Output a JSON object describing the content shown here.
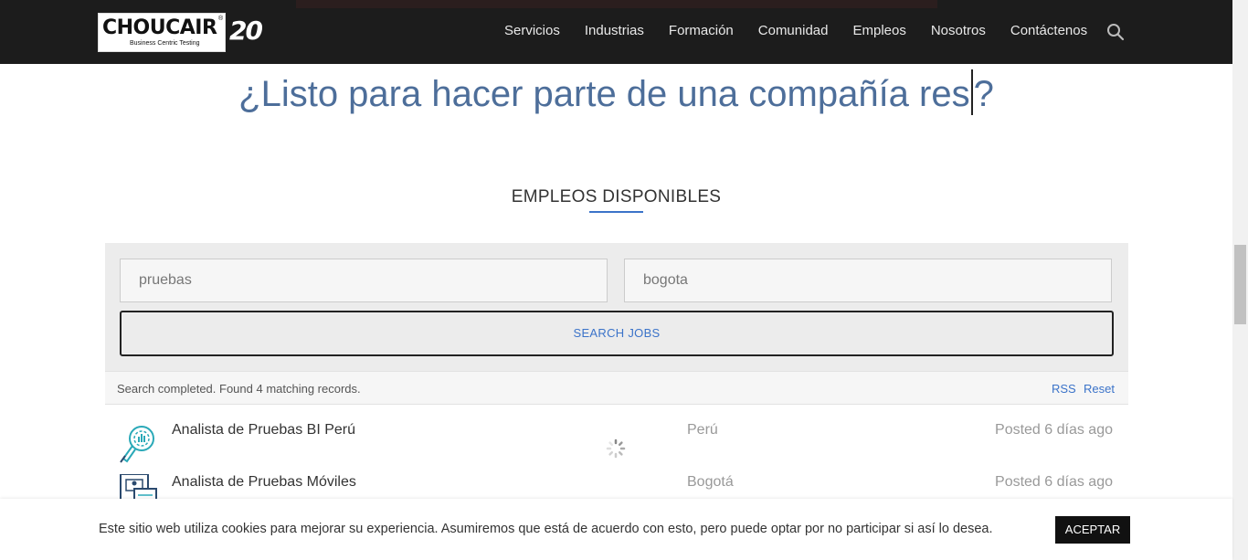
{
  "header": {
    "logo_text": "CHOUCAIR",
    "logo_tagline": "Business Centric Testing",
    "anniversary": "20",
    "nav": [
      "Servicios",
      "Industrias",
      "Formación",
      "Comunidad",
      "Empleos",
      "Nosotros",
      "Contáctenos"
    ],
    "search_icon": "search-icon"
  },
  "hero": {
    "text_before_caret": "¿Listo para hacer parte de una compañía res",
    "text_after_caret": "?"
  },
  "section": {
    "title": "EMPLEOS DISPONIBLES"
  },
  "search": {
    "keywords_value": "pruebas",
    "location_value": "bogota",
    "button_label": "SEARCH JOBS"
  },
  "results": {
    "status": "Search completed. Found 4 matching records.",
    "rss_label": "RSS",
    "reset_label": "Reset"
  },
  "jobs": [
    {
      "title": "Analista de Pruebas BI Perú",
      "location": "Perú",
      "posted": "Posted 6 días ago",
      "icon": "bi-analytics-icon"
    },
    {
      "title": "Analista de Pruebas Móviles",
      "location": "Bogotá",
      "posted": "Posted 6 días ago",
      "icon": "mobile-documents-icon"
    }
  ],
  "cookie": {
    "text": "Este sitio web utiliza cookies para mejorar su experiencia. Asumiremos que está de acuerdo con esto, pero puede optar por no participar si así lo desea.",
    "accept_label": "ACEPTAR"
  },
  "colors": {
    "header_bg": "#1c1c1c",
    "accent_blue": "#3b73c9",
    "hero_blue": "#4d6e9a",
    "icon_teal": "#2aa9b8"
  }
}
